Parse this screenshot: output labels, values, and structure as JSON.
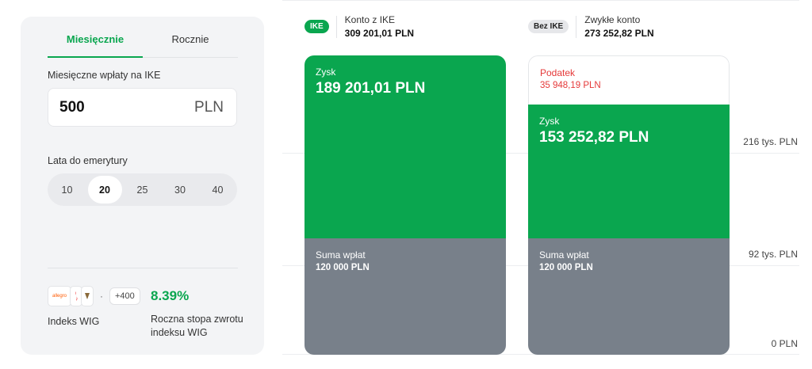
{
  "tabs": [
    "Miesięcznie",
    "Rocznie"
  ],
  "contribution": {
    "label": "Miesięczne wpłaty na IKE",
    "value": "500",
    "unit": "PLN"
  },
  "years": {
    "label": "Lata do emerytury",
    "options": [
      "10",
      "20",
      "25",
      "30",
      "40"
    ],
    "selected": "20"
  },
  "index": {
    "logos": [
      "allegro",
      "santander",
      "pzu"
    ],
    "more": "+400",
    "separator": "·",
    "name": "Indeks WIG",
    "rate": "8.39%",
    "rate_label": "Roczna stopa zwrotu indeksu WIG"
  },
  "ike": {
    "badge": "IKE",
    "title": "Konto z IKE",
    "total": "309 201,01 PLN",
    "profit_label": "Zysk",
    "profit": "189 201,01 PLN",
    "deposits_label": "Suma wpłat",
    "deposits": "120 000 PLN"
  },
  "regular": {
    "badge": "Bez IKE",
    "title": "Zwykłe konto",
    "total": "273 252,82 PLN",
    "tax_label": "Podatek",
    "tax": "35 948,19 PLN",
    "profit_label": "Zysk",
    "profit": "153 252,82 PLN",
    "deposits_label": "Suma wpłat",
    "deposits": "120 000 PLN"
  },
  "axis": [
    "216 tys. PLN",
    "92 tys. PLN",
    "0 PLN"
  ],
  "colors": {
    "accent": "#0aa64f",
    "deposits": "#78808a",
    "tax": "#e53939"
  }
}
